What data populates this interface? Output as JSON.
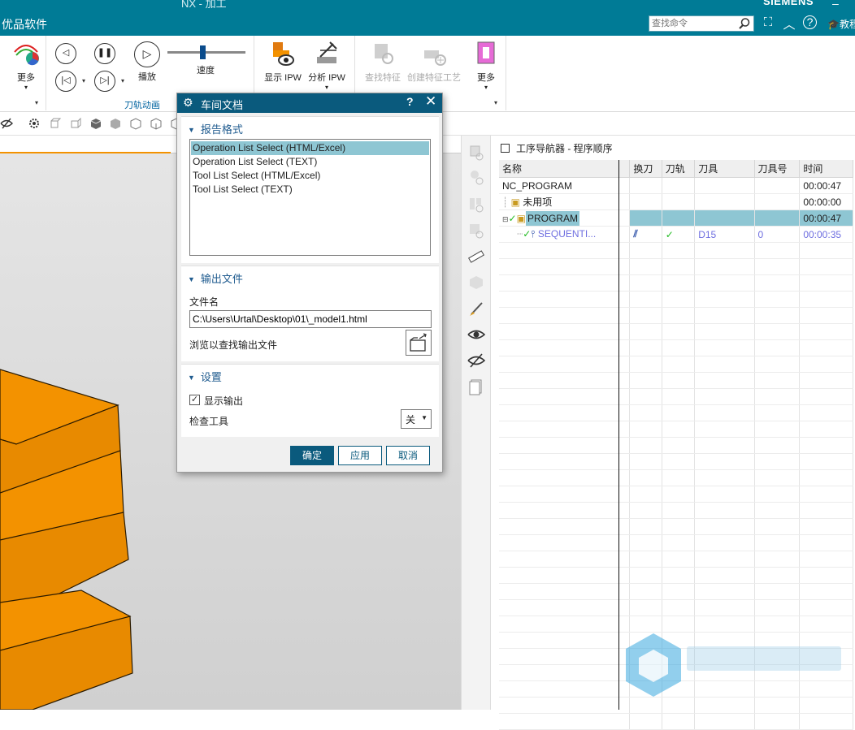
{
  "titlebar": {
    "app_title": "NX - 加工",
    "brand": "优品软件",
    "vendor": "SIEMENS",
    "search_placeholder": "查找命令",
    "tutorial_label": "教程"
  },
  "ribbon": {
    "more_left_label": "更多",
    "play_label": "播放",
    "speed_label": "速度",
    "speed_level": 0.45,
    "animation_group_label": "刀轨动画",
    "show_ipw_label": "显示 IPW",
    "analyze_ipw_label": "分析 IPW",
    "find_feature_label": "查找特征",
    "create_feature_process_label": "创建特征工艺",
    "more_right_label": "更多"
  },
  "dialog": {
    "title": "车间文档",
    "help_symbol": "?",
    "close_symbol": "✕",
    "report_format_header": "报告格式",
    "report_formats": [
      "Operation List Select (HTML/Excel)",
      "Operation List Select (TEXT)",
      "Tool List Select (HTML/Excel)",
      "Tool List Select (TEXT)"
    ],
    "selected_format": "Operation List Select (HTML/Excel)",
    "output_file_header": "输出文件",
    "file_name_label": "文件名",
    "file_name_value": "C:\\Users\\Urtal\\Desktop\\01\\_model1.html",
    "browse_label": "浏览以查找输出文件",
    "settings_header": "设置",
    "show_output_label": "显示输出",
    "show_output_checked": true,
    "check_tool_label": "检查工具",
    "check_tool_value": "关",
    "ok_label": "确定",
    "apply_label": "应用",
    "cancel_label": "取消"
  },
  "navigator": {
    "title": "工序导航器 - 程序顺序",
    "columns": [
      "名称",
      "换刀",
      "刀轨",
      "刀具",
      "刀具号",
      "时间"
    ],
    "rows": [
      {
        "name": "NC_PROGRAM",
        "tool_change": "",
        "toolpath": "",
        "tool": "",
        "tool_no": "",
        "time": "00:00:47"
      },
      {
        "name": "未用项",
        "tool_change": "",
        "toolpath": "",
        "tool": "",
        "tool_no": "",
        "time": "00:00:00"
      },
      {
        "name": "PROGRAM",
        "tool_change": "",
        "toolpath": "",
        "tool": "",
        "tool_no": "",
        "time": "00:00:47"
      },
      {
        "name": "SEQUENTI...",
        "tool_change": "",
        "toolpath": "✓",
        "tool": "D15",
        "tool_no": "0",
        "time": "00:00:35"
      }
    ]
  },
  "colors": {
    "titlebar": "#007B96",
    "dialog_title": "#0a5a7d",
    "selection": "#8ec6d3",
    "part_orange": "#f39200"
  }
}
